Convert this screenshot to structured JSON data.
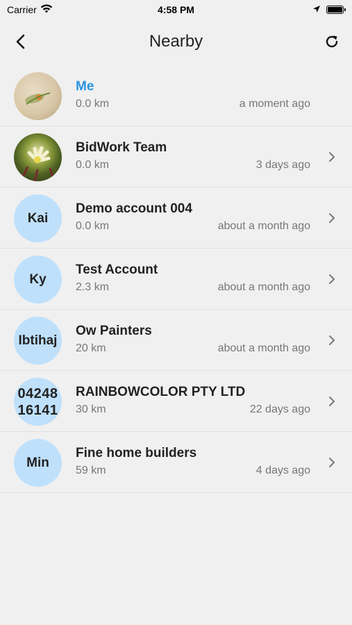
{
  "status": {
    "carrier": "Carrier",
    "time": "4:58 PM"
  },
  "header": {
    "title": "Nearby"
  },
  "contacts": [
    {
      "initials": "",
      "name": "Me",
      "distance": "0.0 km",
      "time": "a moment ago"
    },
    {
      "initials": "",
      "name": "BidWork Team",
      "distance": "0.0 km",
      "time": "3 days ago"
    },
    {
      "initials": "Kai",
      "name": "Demo account 004",
      "distance": "0.0 km",
      "time": "about a month ago"
    },
    {
      "initials": "Ky",
      "name": "Test Account",
      "distance": "2.3 km",
      "time": "about a month ago"
    },
    {
      "initials": "Ibtihaj",
      "name": "Ow Painters",
      "distance": "20 km",
      "time": "about a month ago"
    },
    {
      "initials": "04248 16141",
      "name": "RAINBOWCOLOR PTY LTD",
      "distance": "30 km",
      "time": "22 days ago"
    },
    {
      "initials": "Min",
      "name": "Fine home builders",
      "distance": "59 km",
      "time": "4 days ago"
    }
  ],
  "colors": {
    "accent": "#2a93e0",
    "avatar_bg": "#bfe0fb",
    "background": "#f0f0f0"
  }
}
